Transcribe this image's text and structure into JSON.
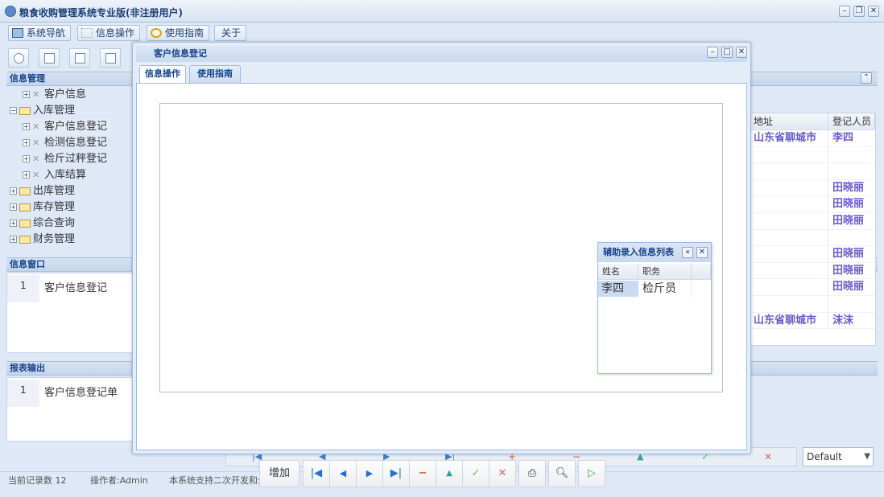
{
  "app": {
    "title": "粮食收购管理系统专业版(非注册用户)"
  },
  "menu": [
    {
      "label": "系统导航",
      "icon": "monitor-icon"
    },
    {
      "label": "信息操作",
      "icon": "grid-icon"
    },
    {
      "label": "使用指南",
      "icon": "help-icon"
    },
    {
      "label": "关于"
    }
  ],
  "sidebar": {
    "info_mgmt_title": "信息管理",
    "tree": [
      {
        "label": "客户信息",
        "level": 2,
        "icon": "tool-icon"
      },
      {
        "label": "入库管理",
        "level": 1,
        "icon": "folder-icon",
        "expanded": true
      },
      {
        "label": "客户信息登记",
        "level": 2,
        "icon": "tool-icon",
        "selected": true
      },
      {
        "label": "检测信息登记",
        "level": 2,
        "icon": "tool-icon"
      },
      {
        "label": "检斤过秤登记",
        "level": 2,
        "icon": "tool-icon"
      },
      {
        "label": "入库结算",
        "level": 2,
        "icon": "tool-icon"
      },
      {
        "label": "出库管理",
        "level": 1,
        "icon": "folder-icon"
      },
      {
        "label": "库存管理",
        "level": 1,
        "icon": "folder-icon"
      },
      {
        "label": "综合查询",
        "level": 1,
        "icon": "folder-icon"
      },
      {
        "label": "财务管理",
        "level": 1,
        "icon": "folder-icon"
      }
    ],
    "info_window_title": "信息窗口",
    "info_window_rows": [
      {
        "no": "1",
        "label": "客户信息登记"
      }
    ],
    "report_title": "报表输出",
    "report_rows": [
      {
        "no": "1",
        "label": "客户信息登记单"
      }
    ]
  },
  "grid": {
    "headers": [
      "地址",
      "登记人员"
    ],
    "rows": [
      [
        "山东省聊城市",
        "李四"
      ],
      [
        "",
        ""
      ],
      [
        "",
        ""
      ],
      [
        "",
        "田晓丽"
      ],
      [
        "",
        "田晓丽"
      ],
      [
        "",
        "田晓丽"
      ],
      [
        "",
        ""
      ],
      [
        "",
        "田晓丽"
      ],
      [
        "",
        "田晓丽"
      ],
      [
        "",
        "田晓丽"
      ],
      [
        "",
        ""
      ],
      [
        "山东省聊城市",
        "沫沫"
      ]
    ]
  },
  "bottom": {
    "select_value": "Default"
  },
  "status": {
    "records": "当前记录数 12",
    "operator": "操作者:Admin",
    "message": "本系统支持二次开发和全新开发!"
  },
  "dialog": {
    "title": "客户信息登记",
    "tabs": [
      "信息操作",
      "使用指南"
    ],
    "add_label": "增加"
  },
  "popup": {
    "title": "辅助录入信息列表",
    "headers": [
      "姓名",
      "职务"
    ],
    "rows": [
      [
        "李四",
        "检斤员"
      ]
    ]
  },
  "colors": {
    "accent": "#15428b",
    "name_text": "#6a5acd"
  }
}
